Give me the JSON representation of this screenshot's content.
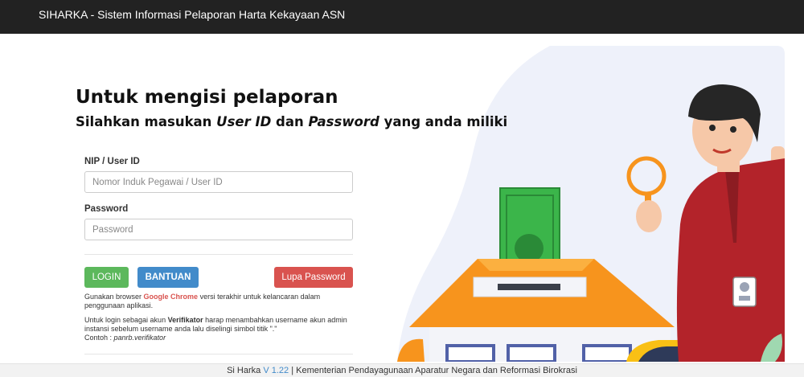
{
  "navbar": {
    "brand": "SIHARKA - Sistem Informasi Pelaporan Harta Kekayaan ASN"
  },
  "hero": {
    "title": "Untuk mengisi pelaporan",
    "subtitle_a": "Silahkan masukan ",
    "subtitle_b": "User ID",
    "subtitle_c": " dan ",
    "subtitle_d": "Password",
    "subtitle_e": " yang anda miliki"
  },
  "form": {
    "userid_label": "NIP / User ID",
    "userid_placeholder": "Nomor Induk Pegawai / User ID",
    "userid_value": "",
    "password_label": "Password",
    "password_placeholder": "Password",
    "password_value": ""
  },
  "buttons": {
    "login": "LOGIN",
    "bantuan": "BANTUAN",
    "lupa": "Lupa Password"
  },
  "notes": {
    "browser_a": "Gunakan browser ",
    "browser_b": "Google Chrome",
    "browser_c": " versi terakhir untuk kelancaran dalam penggunaan aplikasi.",
    "verif_a": "Untuk login sebagai akun ",
    "verif_b": "Verifikator",
    "verif_c": " harap menambahkan username akun admin instansi sebelum username anda lalu diselingi simbol titik \".\"",
    "example_a": "Contoh : ",
    "example_b": "panrb.verifikator"
  },
  "footer": {
    "app": "Si Harka ",
    "version": "V 1.22",
    "rest": " | Kementerian Pendayagunaan Aparatur Negara dan Reformasi Birokrasi"
  },
  "colors": {
    "navbar": "#222222",
    "login": "#5cb85c",
    "bantuan": "#428bca",
    "lupa": "#d9534f",
    "hero_bg": "#eef1fa",
    "roof": "#f7941d",
    "money": "#3bb54a",
    "shirt": "#b3232a"
  },
  "icons": {
    "illustration": "man-with-magnifier-house-money-illustration"
  }
}
